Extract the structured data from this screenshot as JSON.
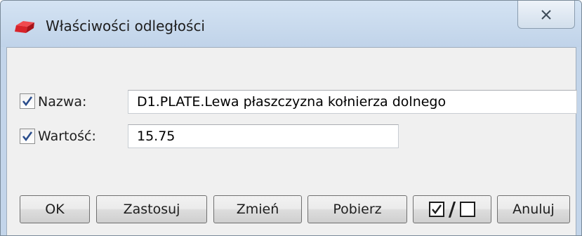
{
  "window": {
    "title": "Właściwości odległości",
    "close_icon": "close-icon",
    "app_icon": "red-box-icon"
  },
  "fields": {
    "name": {
      "label": "Nazwa:",
      "checked": true,
      "value": "D1.PLATE.Lewa płaszczyzna kołnierza dolnego"
    },
    "value": {
      "label": "Wartość:",
      "checked": true,
      "value": "15.75"
    }
  },
  "buttons": {
    "ok": "OK",
    "apply": "Zastosuj",
    "modify": "Zmień",
    "get": "Pobierz",
    "toggle_all_icon": "check-uncheck-toggle-icon",
    "cancel": "Anuluj"
  },
  "colors": {
    "titlebar": "#c3d5ea",
    "client": "#f0f0f0",
    "check": "#2a4d8c",
    "app_icon_red": "#d8232a"
  }
}
